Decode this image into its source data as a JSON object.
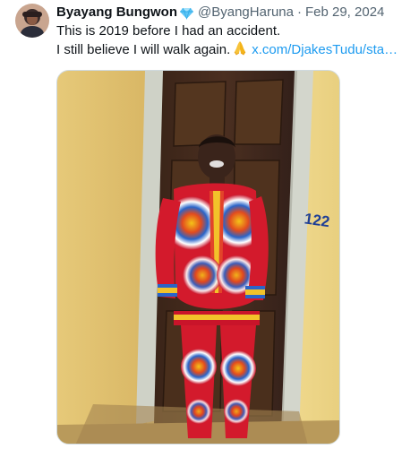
{
  "tweet": {
    "author": {
      "display_name": "Byayang Bungwon",
      "handle": "@ByangHaruna",
      "verified_badge_icon": "verified-diamond-icon",
      "avatar_icon": "avatar"
    },
    "separator": "·",
    "date": "Feb 29, 2024",
    "text_line_1": "This is 2019 before I had an accident.",
    "text_line_2_prefix": "I still believe I will walk again.",
    "emoji_icon": "folded-hands-emoji",
    "link_text": "x.com/DjakesTudu/sta…",
    "media": {
      "type": "photo",
      "wall_text": "122"
    }
  },
  "colors": {
    "text_primary": "#0f1419",
    "text_secondary": "#536471",
    "link": "#1d9bf0",
    "border": "#cfd9de",
    "verified_badge": "#5ec5f5"
  }
}
